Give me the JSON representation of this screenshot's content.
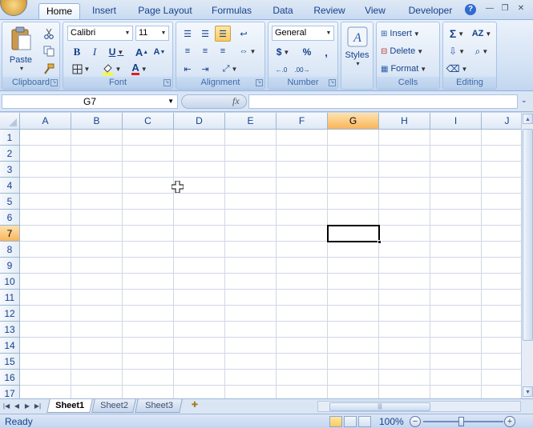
{
  "ribbon_tabs": [
    "Home",
    "Insert",
    "Page Layout",
    "Formulas",
    "Data",
    "Review",
    "View",
    "Developer"
  ],
  "active_tab": "Home",
  "groups": {
    "clipboard": {
      "label": "Clipboard",
      "paste": "Paste"
    },
    "font": {
      "label": "Font",
      "font_name": "Calibri",
      "font_size": "11"
    },
    "alignment": {
      "label": "Alignment"
    },
    "number": {
      "label": "Number",
      "format": "General",
      "currency": "$",
      "percent": "%",
      "comma": ","
    },
    "styles": {
      "label": "Styles"
    },
    "cells": {
      "label": "Cells",
      "insert": "Insert",
      "delete": "Delete",
      "format": "Format"
    },
    "editing": {
      "label": "Editing"
    }
  },
  "formula_bar": {
    "name_box": "G7",
    "fx": "fx",
    "formula": ""
  },
  "columns": [
    "A",
    "B",
    "C",
    "D",
    "E",
    "F",
    "G",
    "H",
    "I",
    "J"
  ],
  "rows": [
    "1",
    "2",
    "3",
    "4",
    "5",
    "6",
    "7",
    "8",
    "9",
    "10",
    "11",
    "12",
    "13",
    "14",
    "15",
    "16",
    "17"
  ],
  "selected_cell": {
    "column": "G",
    "row": "7"
  },
  "sheets": [
    "Sheet1",
    "Sheet2",
    "Sheet3"
  ],
  "active_sheet": "Sheet1",
  "status": {
    "text": "Ready",
    "zoom": "100%"
  },
  "colors": {
    "accent": "#15428b",
    "selection_header": "#f9b55a",
    "ribbon": "#d1e1f4"
  }
}
